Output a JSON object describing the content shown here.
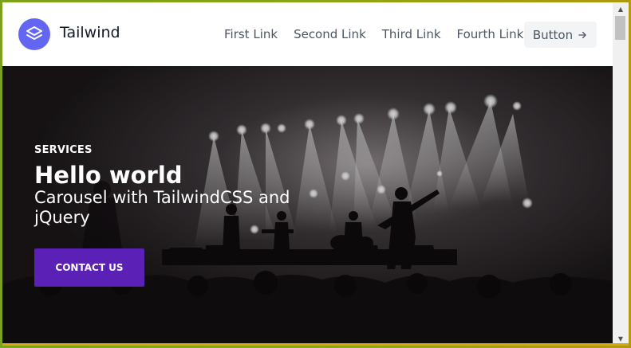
{
  "header": {
    "brand": "Tailwind",
    "nav": [
      "First Link",
      "Second Link",
      "Third Link",
      "Fourth Link"
    ],
    "button_label": "Button",
    "button_icon": "arrow-right-icon"
  },
  "hero": {
    "eyebrow": "SERVICES",
    "title": "Hello world",
    "subtitle": "Carousel with TailwindCSS and jQuery",
    "cta_label": "CONTACT US",
    "background": "concert-stage-photo"
  },
  "colors": {
    "accent": "#6366f1",
    "cta": "#5b21b6",
    "hero_bg": "#1f1a1d"
  }
}
